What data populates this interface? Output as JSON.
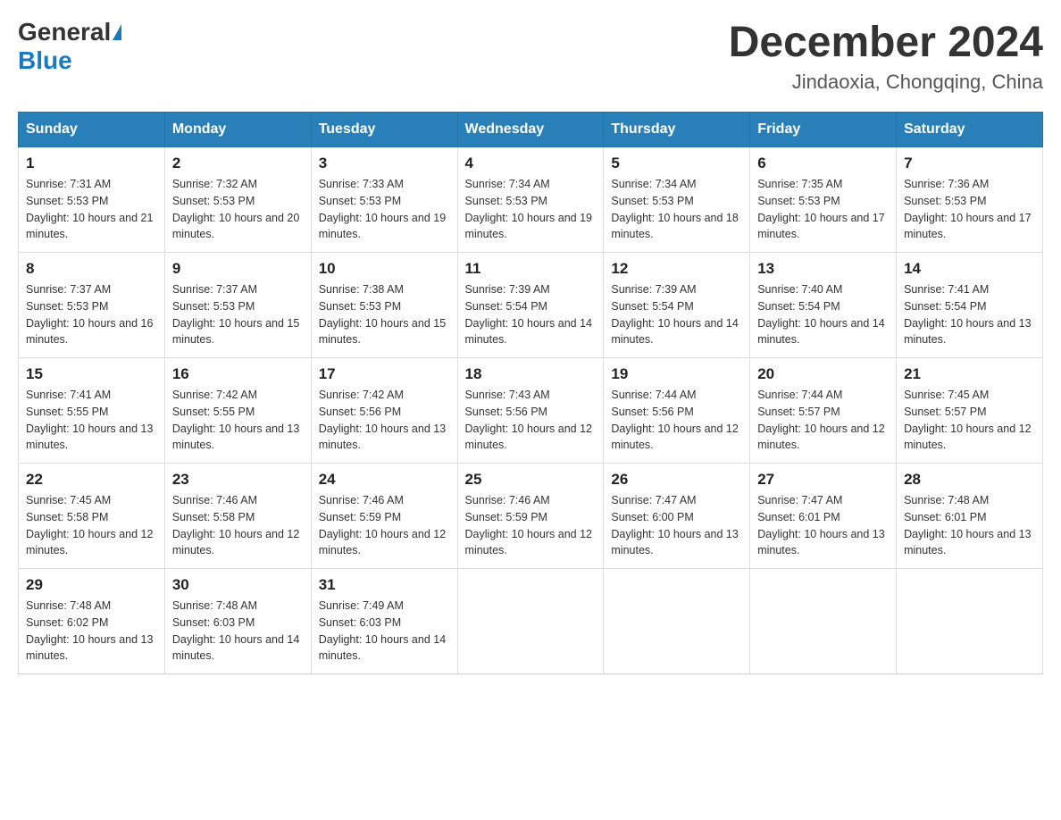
{
  "header": {
    "logo": {
      "general": "General",
      "blue": "Blue",
      "triangle": "▶"
    },
    "title": "December 2024",
    "location": "Jindaoxia, Chongqing, China"
  },
  "calendar": {
    "days_of_week": [
      "Sunday",
      "Monday",
      "Tuesday",
      "Wednesday",
      "Thursday",
      "Friday",
      "Saturday"
    ],
    "weeks": [
      [
        {
          "day": "1",
          "sunrise": "7:31 AM",
          "sunset": "5:53 PM",
          "daylight": "10 hours and 21 minutes."
        },
        {
          "day": "2",
          "sunrise": "7:32 AM",
          "sunset": "5:53 PM",
          "daylight": "10 hours and 20 minutes."
        },
        {
          "day": "3",
          "sunrise": "7:33 AM",
          "sunset": "5:53 PM",
          "daylight": "10 hours and 19 minutes."
        },
        {
          "day": "4",
          "sunrise": "7:34 AM",
          "sunset": "5:53 PM",
          "daylight": "10 hours and 19 minutes."
        },
        {
          "day": "5",
          "sunrise": "7:34 AM",
          "sunset": "5:53 PM",
          "daylight": "10 hours and 18 minutes."
        },
        {
          "day": "6",
          "sunrise": "7:35 AM",
          "sunset": "5:53 PM",
          "daylight": "10 hours and 17 minutes."
        },
        {
          "day": "7",
          "sunrise": "7:36 AM",
          "sunset": "5:53 PM",
          "daylight": "10 hours and 17 minutes."
        }
      ],
      [
        {
          "day": "8",
          "sunrise": "7:37 AM",
          "sunset": "5:53 PM",
          "daylight": "10 hours and 16 minutes."
        },
        {
          "day": "9",
          "sunrise": "7:37 AM",
          "sunset": "5:53 PM",
          "daylight": "10 hours and 15 minutes."
        },
        {
          "day": "10",
          "sunrise": "7:38 AM",
          "sunset": "5:53 PM",
          "daylight": "10 hours and 15 minutes."
        },
        {
          "day": "11",
          "sunrise": "7:39 AM",
          "sunset": "5:54 PM",
          "daylight": "10 hours and 14 minutes."
        },
        {
          "day": "12",
          "sunrise": "7:39 AM",
          "sunset": "5:54 PM",
          "daylight": "10 hours and 14 minutes."
        },
        {
          "day": "13",
          "sunrise": "7:40 AM",
          "sunset": "5:54 PM",
          "daylight": "10 hours and 14 minutes."
        },
        {
          "day": "14",
          "sunrise": "7:41 AM",
          "sunset": "5:54 PM",
          "daylight": "10 hours and 13 minutes."
        }
      ],
      [
        {
          "day": "15",
          "sunrise": "7:41 AM",
          "sunset": "5:55 PM",
          "daylight": "10 hours and 13 minutes."
        },
        {
          "day": "16",
          "sunrise": "7:42 AM",
          "sunset": "5:55 PM",
          "daylight": "10 hours and 13 minutes."
        },
        {
          "day": "17",
          "sunrise": "7:42 AM",
          "sunset": "5:56 PM",
          "daylight": "10 hours and 13 minutes."
        },
        {
          "day": "18",
          "sunrise": "7:43 AM",
          "sunset": "5:56 PM",
          "daylight": "10 hours and 12 minutes."
        },
        {
          "day": "19",
          "sunrise": "7:44 AM",
          "sunset": "5:56 PM",
          "daylight": "10 hours and 12 minutes."
        },
        {
          "day": "20",
          "sunrise": "7:44 AM",
          "sunset": "5:57 PM",
          "daylight": "10 hours and 12 minutes."
        },
        {
          "day": "21",
          "sunrise": "7:45 AM",
          "sunset": "5:57 PM",
          "daylight": "10 hours and 12 minutes."
        }
      ],
      [
        {
          "day": "22",
          "sunrise": "7:45 AM",
          "sunset": "5:58 PM",
          "daylight": "10 hours and 12 minutes."
        },
        {
          "day": "23",
          "sunrise": "7:46 AM",
          "sunset": "5:58 PM",
          "daylight": "10 hours and 12 minutes."
        },
        {
          "day": "24",
          "sunrise": "7:46 AM",
          "sunset": "5:59 PM",
          "daylight": "10 hours and 12 minutes."
        },
        {
          "day": "25",
          "sunrise": "7:46 AM",
          "sunset": "5:59 PM",
          "daylight": "10 hours and 12 minutes."
        },
        {
          "day": "26",
          "sunrise": "7:47 AM",
          "sunset": "6:00 PM",
          "daylight": "10 hours and 13 minutes."
        },
        {
          "day": "27",
          "sunrise": "7:47 AM",
          "sunset": "6:01 PM",
          "daylight": "10 hours and 13 minutes."
        },
        {
          "day": "28",
          "sunrise": "7:48 AM",
          "sunset": "6:01 PM",
          "daylight": "10 hours and 13 minutes."
        }
      ],
      [
        {
          "day": "29",
          "sunrise": "7:48 AM",
          "sunset": "6:02 PM",
          "daylight": "10 hours and 13 minutes."
        },
        {
          "day": "30",
          "sunrise": "7:48 AM",
          "sunset": "6:03 PM",
          "daylight": "10 hours and 14 minutes."
        },
        {
          "day": "31",
          "sunrise": "7:49 AM",
          "sunset": "6:03 PM",
          "daylight": "10 hours and 14 minutes."
        },
        null,
        null,
        null,
        null
      ]
    ]
  }
}
